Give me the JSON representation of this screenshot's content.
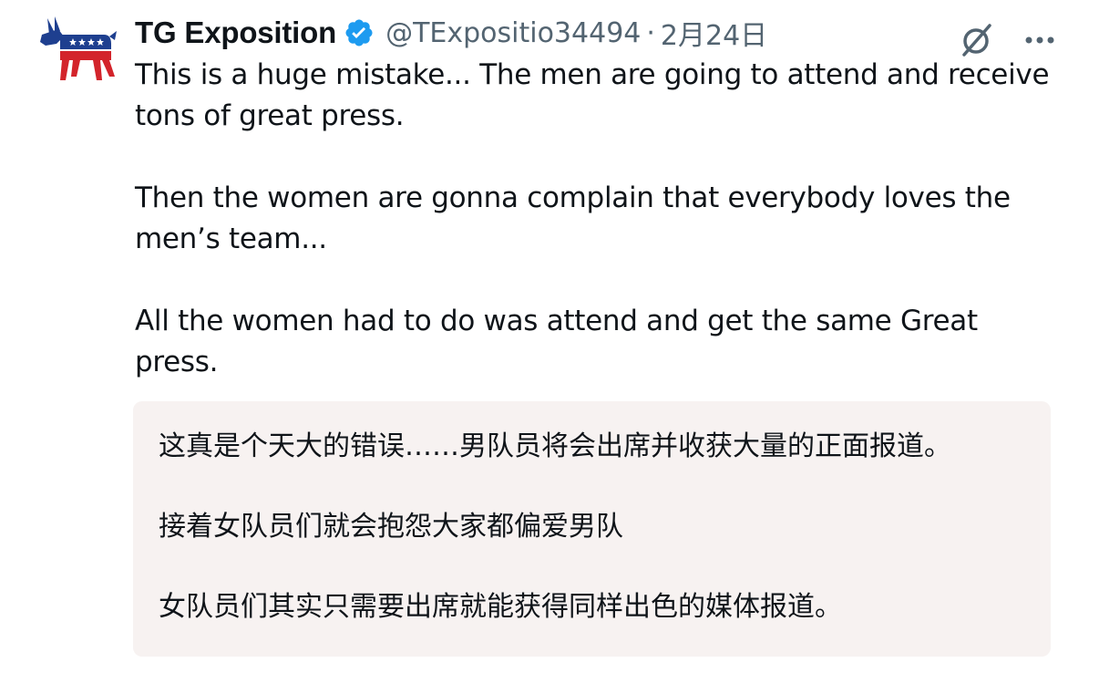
{
  "tweet": {
    "display_name": "TG Exposition",
    "handle": "@TExpositio34494",
    "separator": "·",
    "timestamp": "2月24日",
    "avatar_icon": "donkey-logo",
    "verified_icon": "verified-badge-icon",
    "action_icons": [
      "grok-icon",
      "more-options-icon"
    ],
    "text_lines": [
      "This is a huge mistake... The men are going to attend and receive",
      "tons of great press.",
      "Then the women are gonna complain that everybody loves the",
      "men’s team...",
      "All the women had to do was attend and get the same Great",
      "press."
    ],
    "translation_lines": [
      "这真是个天大的错误……男队员将会出席并收获大量的正面报道。",
      "接着女队员们就会抱怨大家都偏爱男队",
      "女队员们其实只需要出席就能获得同样出色的媒体报道。"
    ]
  },
  "colors": {
    "verified": "#1d9bf0",
    "secondary_text": "#536471",
    "translation_bg": "#f7f2f1",
    "logo_blue": "#1e3f8f",
    "logo_red": "#d3242b"
  }
}
